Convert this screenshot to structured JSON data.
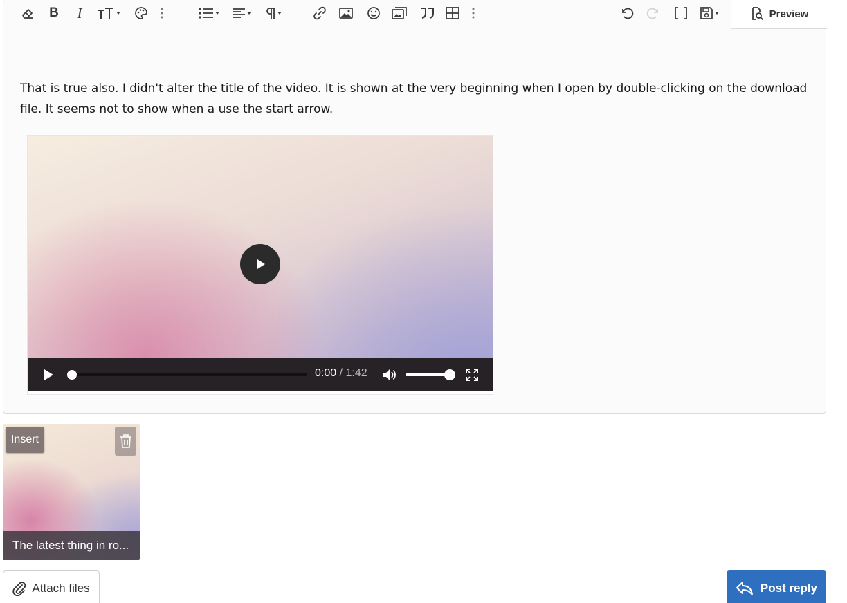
{
  "toolbar": {
    "buttons": [
      {
        "name": "eraser-icon"
      },
      {
        "name": "bold-icon"
      },
      {
        "name": "italic-icon"
      },
      {
        "name": "text-size-icon"
      },
      {
        "name": "palette-icon"
      },
      {
        "name": "more-vertical-icon"
      },
      {
        "name": "list-icon"
      },
      {
        "name": "align-icon"
      },
      {
        "name": "paragraph-icon"
      },
      {
        "name": "link-icon"
      },
      {
        "name": "image-icon"
      },
      {
        "name": "smiley-icon"
      },
      {
        "name": "media-gallery-icon"
      },
      {
        "name": "quote-icon"
      },
      {
        "name": "table-icon"
      },
      {
        "name": "more-vertical-icon"
      },
      {
        "name": "undo-icon"
      },
      {
        "name": "redo-icon"
      },
      {
        "name": "brackets-icon"
      },
      {
        "name": "save-draft-icon"
      }
    ],
    "preview_label": "Preview"
  },
  "editor": {
    "text": "That is true also.  I didn't alter the title of the video.  It is shown at the very beginning when I open by double-clicking on the download file.  It seems not to show when a use the start arrow."
  },
  "video": {
    "current_time": "0:00",
    "separator": "/",
    "duration": "1:42",
    "progress_fraction": 0,
    "volume_fraction": 1
  },
  "attachment": {
    "insert_label": "Insert",
    "caption": "The latest thing in ro..."
  },
  "actions": {
    "attach_label": "Attach files",
    "post_label": "Post reply"
  },
  "colors": {
    "primary_button": "#2f6fbf",
    "video_controls": "#262226"
  }
}
